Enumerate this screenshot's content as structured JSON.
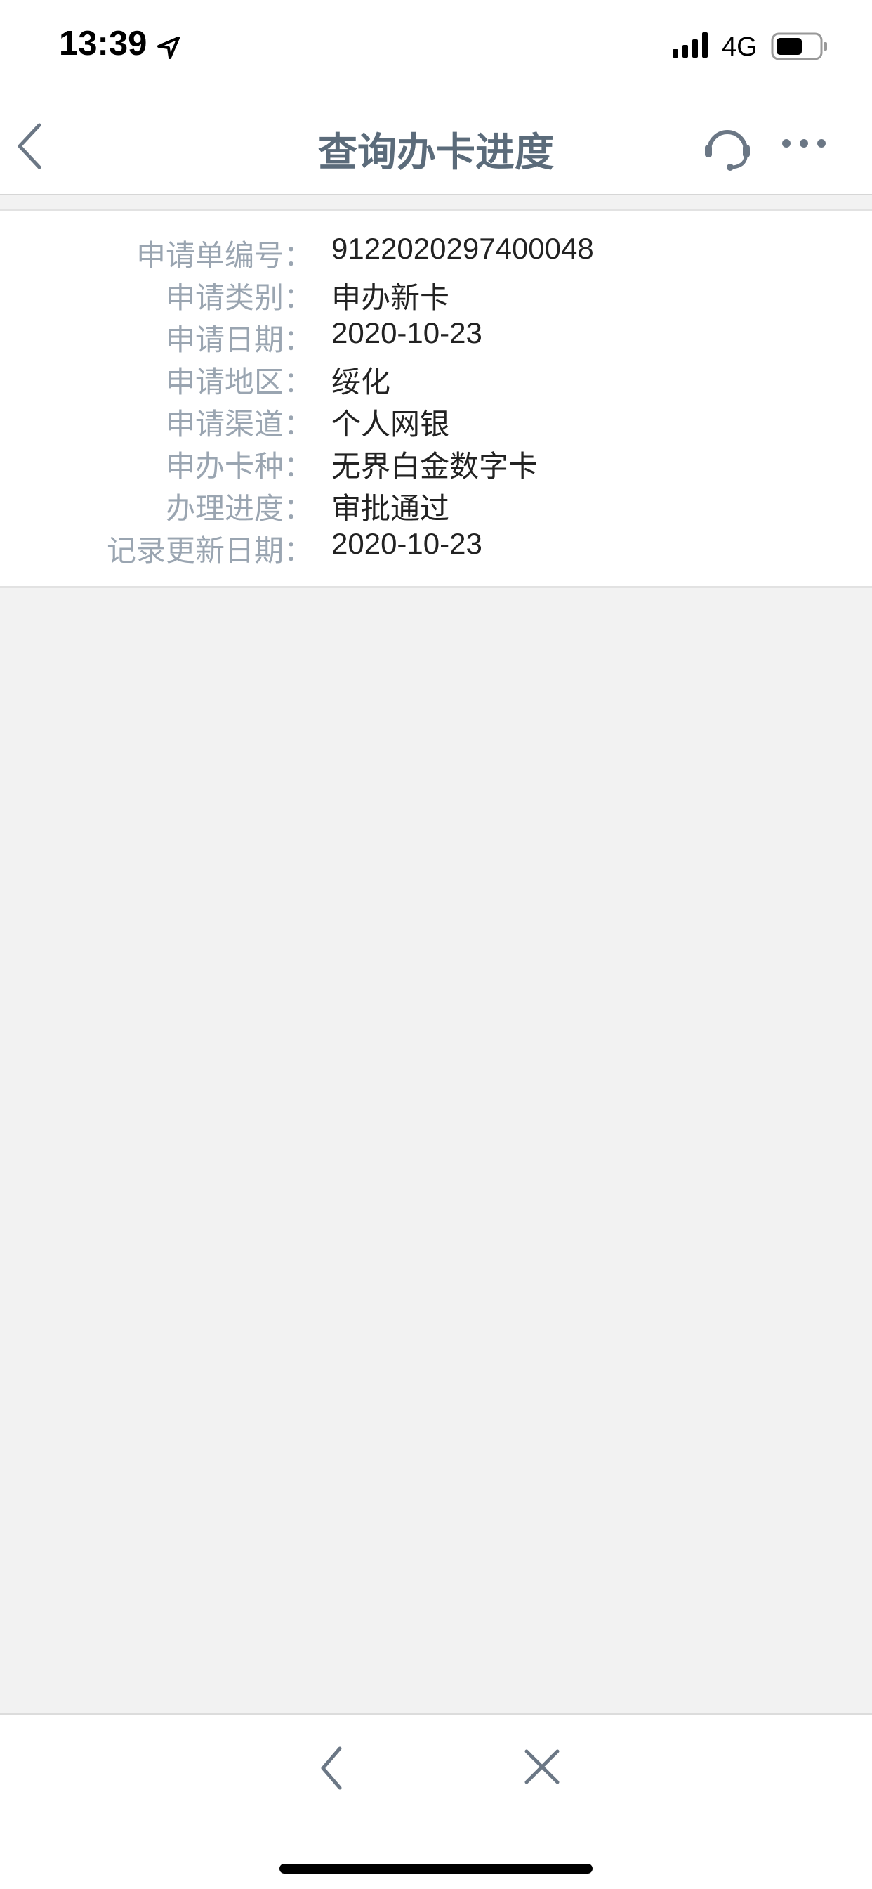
{
  "status_bar": {
    "time": "13:39",
    "network": "4G",
    "icons": [
      "location-arrow-icon",
      "signal-icon",
      "battery-icon"
    ]
  },
  "nav": {
    "title": "查询办卡进度",
    "icons": [
      "back-chevron-icon",
      "headset-icon",
      "more-dots-icon"
    ],
    "title_color": "#5b6b7a"
  },
  "details": [
    {
      "label": "申请单编号：",
      "value": "9122020297400048"
    },
    {
      "label": "申请类别：",
      "value": "申办新卡"
    },
    {
      "label": "申请日期：",
      "value": "2020-10-23"
    },
    {
      "label": "申请地区：",
      "value": "绥化"
    },
    {
      "label": "申请渠道：",
      "value": "个人网银"
    },
    {
      "label": "申办卡种：",
      "value": "无界白金数字卡"
    },
    {
      "label": "办理进度：",
      "value": "审批通过"
    },
    {
      "label": "记录更新日期：",
      "value": "2020-10-23"
    }
  ],
  "toolbar": {
    "icons": [
      "back-chevron-icon",
      "close-icon"
    ]
  },
  "colors": {
    "background": "#f2f2f2",
    "label": "#9aa5b1",
    "value": "#222222",
    "icon": "#6b7785"
  }
}
